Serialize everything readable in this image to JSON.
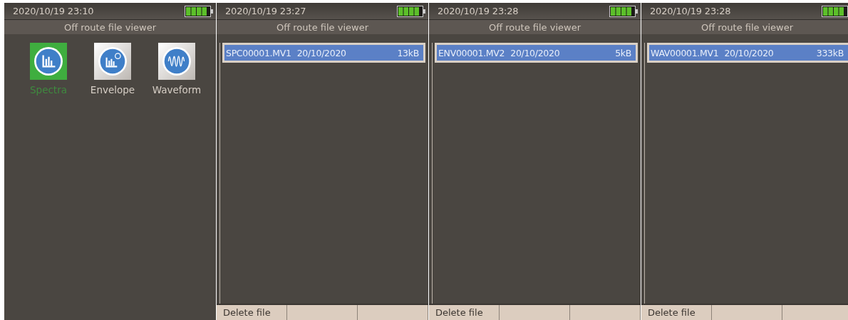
{
  "panels": [
    {
      "kind": "menu",
      "datetime": "2020/10/19 23:10",
      "title": "Off route file viewer",
      "items": [
        {
          "label": "Spectra",
          "kind": "spectra",
          "selected": true
        },
        {
          "label": "Envelope",
          "kind": "envelope",
          "selected": false
        },
        {
          "label": "Waveform",
          "kind": "waveform",
          "selected": false
        }
      ]
    },
    {
      "kind": "files",
      "datetime": "2020/10/19 23:27",
      "title": "Off route file viewer",
      "files": [
        {
          "name": "SPC00001.MV1",
          "date": "20/10/2020",
          "size": "13kB",
          "selected": true
        }
      ],
      "softkeys": [
        "Delete file"
      ]
    },
    {
      "kind": "files",
      "datetime": "2020/10/19 23:28",
      "title": "Off route file viewer",
      "files": [
        {
          "name": "ENV00001.MV2",
          "date": "20/10/2020",
          "size": "5kB",
          "selected": true
        }
      ],
      "softkeys": [
        "Delete file"
      ]
    },
    {
      "kind": "files",
      "datetime": "2020/10/19 23:28",
      "title": "Off route file viewer",
      "files": [
        {
          "name": "WAV00001.MV1",
          "date": "20/10/2020",
          "size": "333kB",
          "selected": true
        }
      ],
      "softkeys": [
        "Delete file"
      ]
    }
  ]
}
